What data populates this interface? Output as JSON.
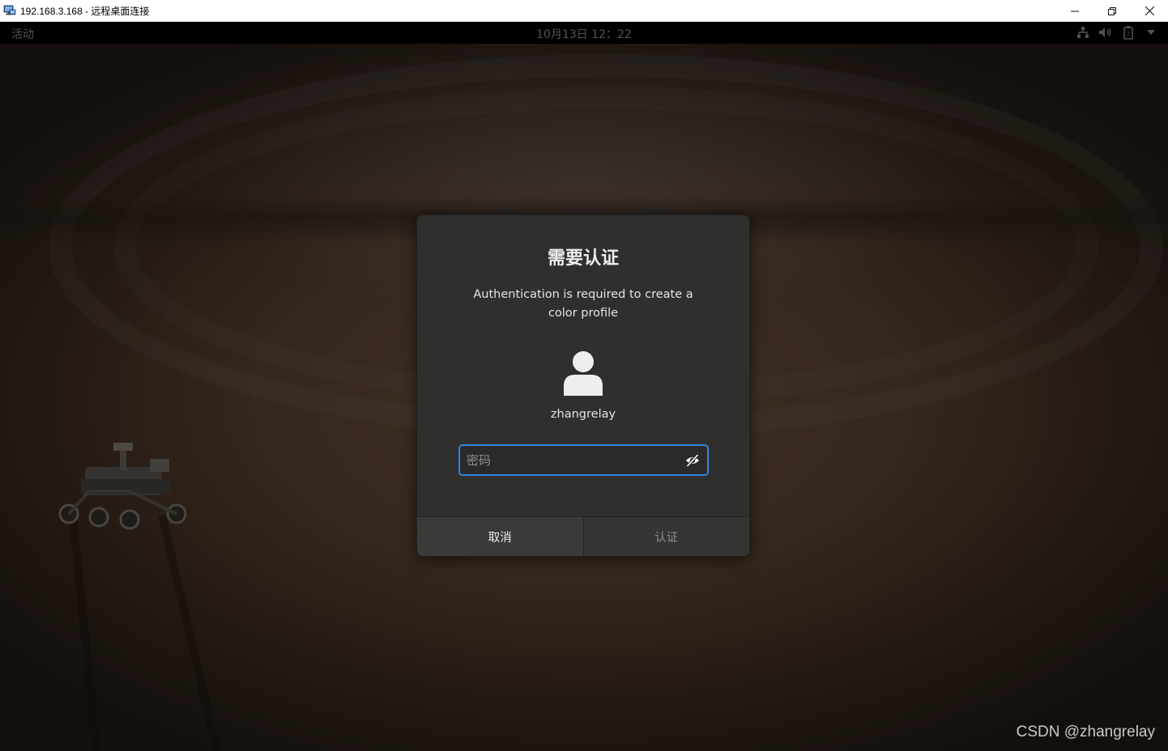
{
  "window": {
    "title": "192.168.3.168 - 远程桌面连接",
    "controls": [
      "minimize",
      "restore",
      "close"
    ]
  },
  "top_bar": {
    "activities_label": "活动",
    "clock": "10月13日  12：22",
    "tray_icons": [
      "network-icon",
      "volume-icon",
      "battery-icon",
      "dropdown-arrow-icon"
    ]
  },
  "dialog": {
    "title": "需要认证",
    "description": "Authentication is required to create a color profile",
    "username": "zhangrelay",
    "password_placeholder": "密码",
    "password_value": "",
    "cancel_label": "取消",
    "authenticate_label": "认证"
  },
  "watermark": "CSDN @zhangrelay",
  "colors": {
    "accent": "#3584e4",
    "dialog_bg": "#2f302e",
    "top_bar_bg": "#000000"
  }
}
